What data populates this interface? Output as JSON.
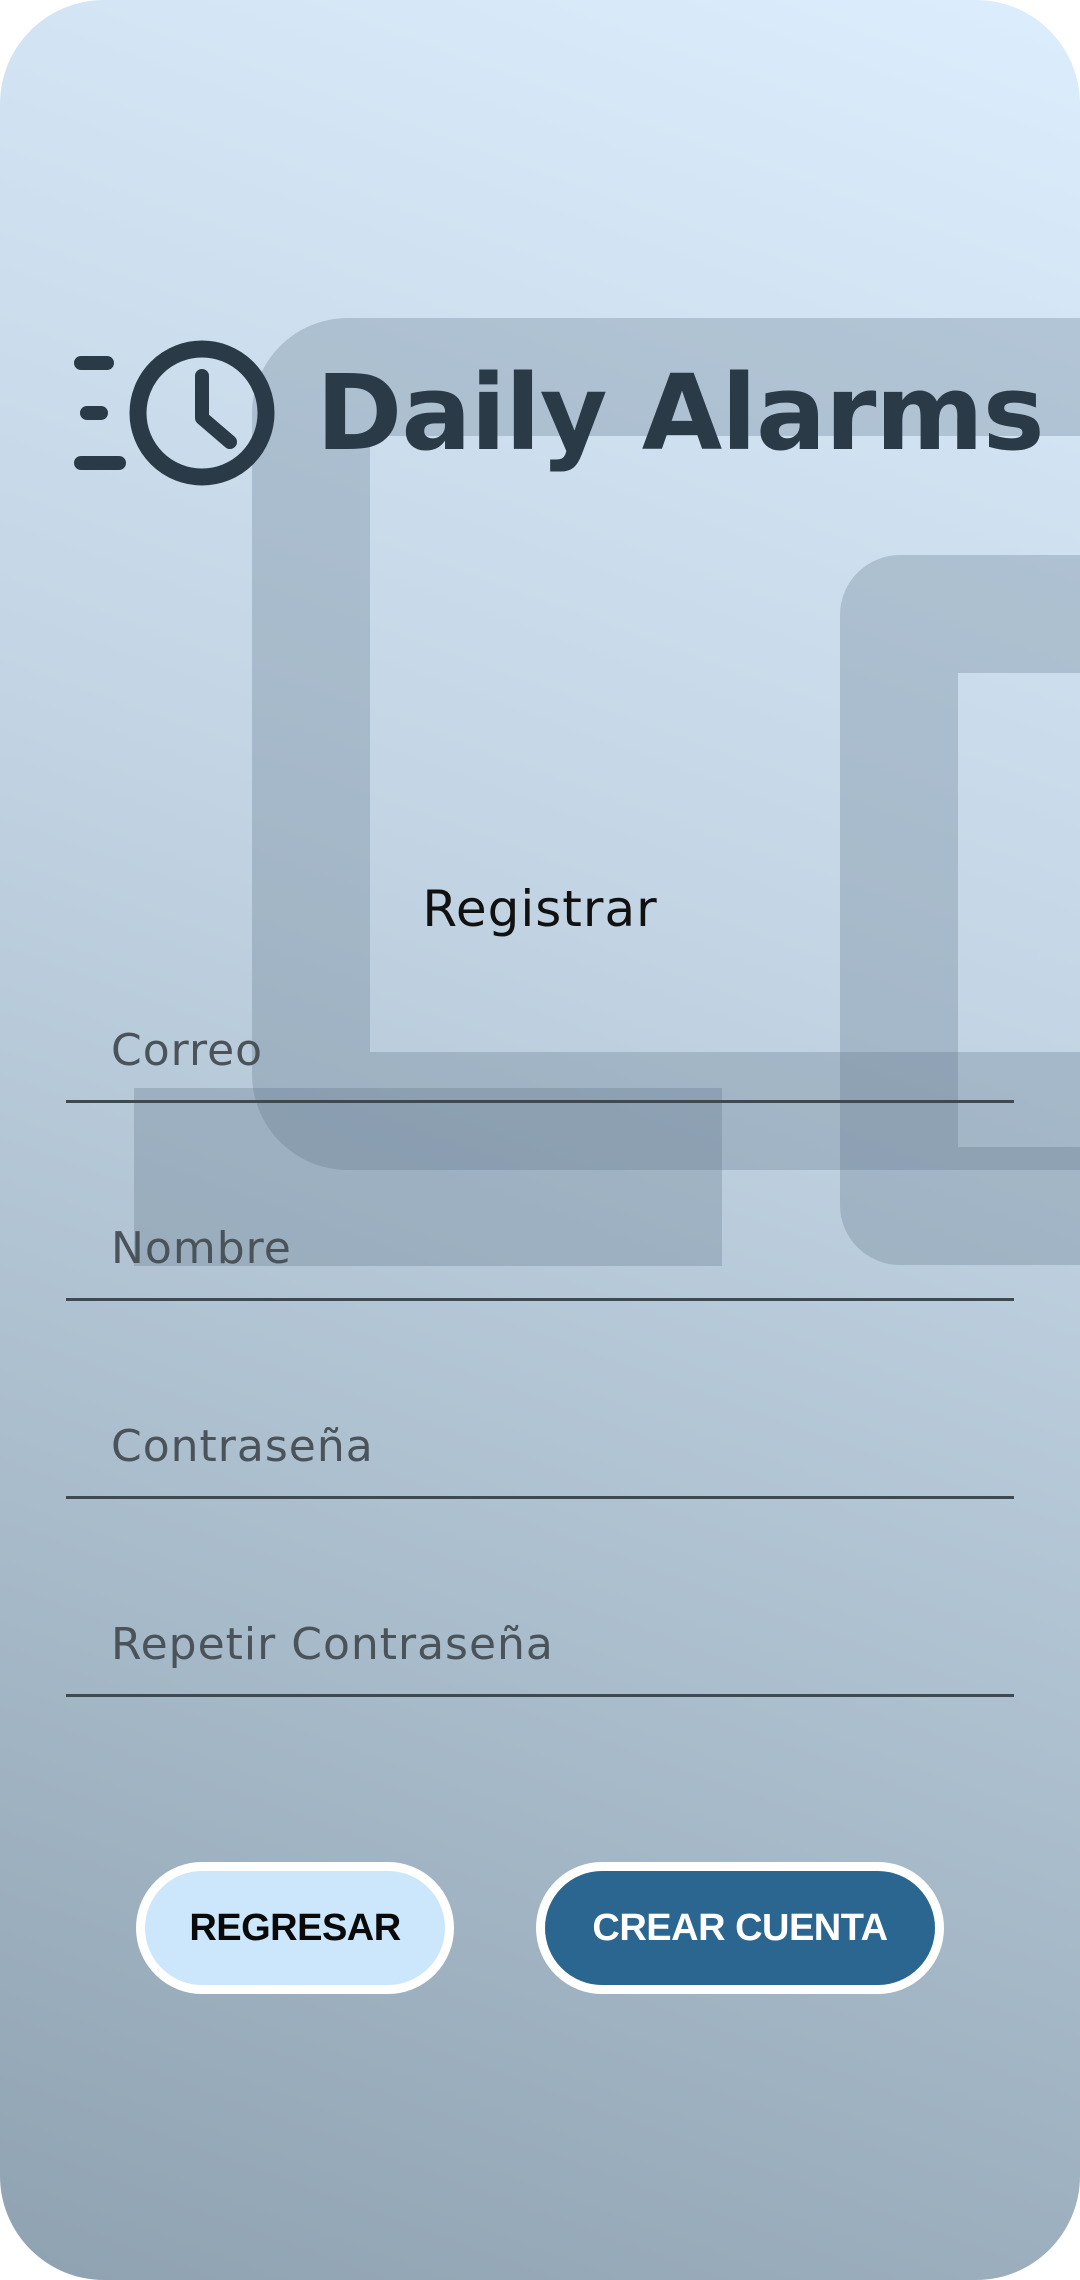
{
  "app": {
    "name": "Daily Alarms",
    "logo_icon": "clock-fast-icon"
  },
  "form": {
    "title": "Registrar",
    "fields": [
      {
        "name": "email",
        "value": "",
        "placeholder": "Correo"
      },
      {
        "name": "name",
        "value": "",
        "placeholder": "Nombre"
      },
      {
        "name": "password",
        "value": "",
        "placeholder": "Contraseña"
      },
      {
        "name": "repeat-password",
        "value": "",
        "placeholder": "Repetir Contraseña"
      }
    ]
  },
  "buttons": {
    "back_label": "REGRESAR",
    "create_label": "CREAR CUENTA"
  },
  "colors": {
    "primary": "#2a6690",
    "secondary": "#cce6fb",
    "logo": "#2b3a47"
  }
}
